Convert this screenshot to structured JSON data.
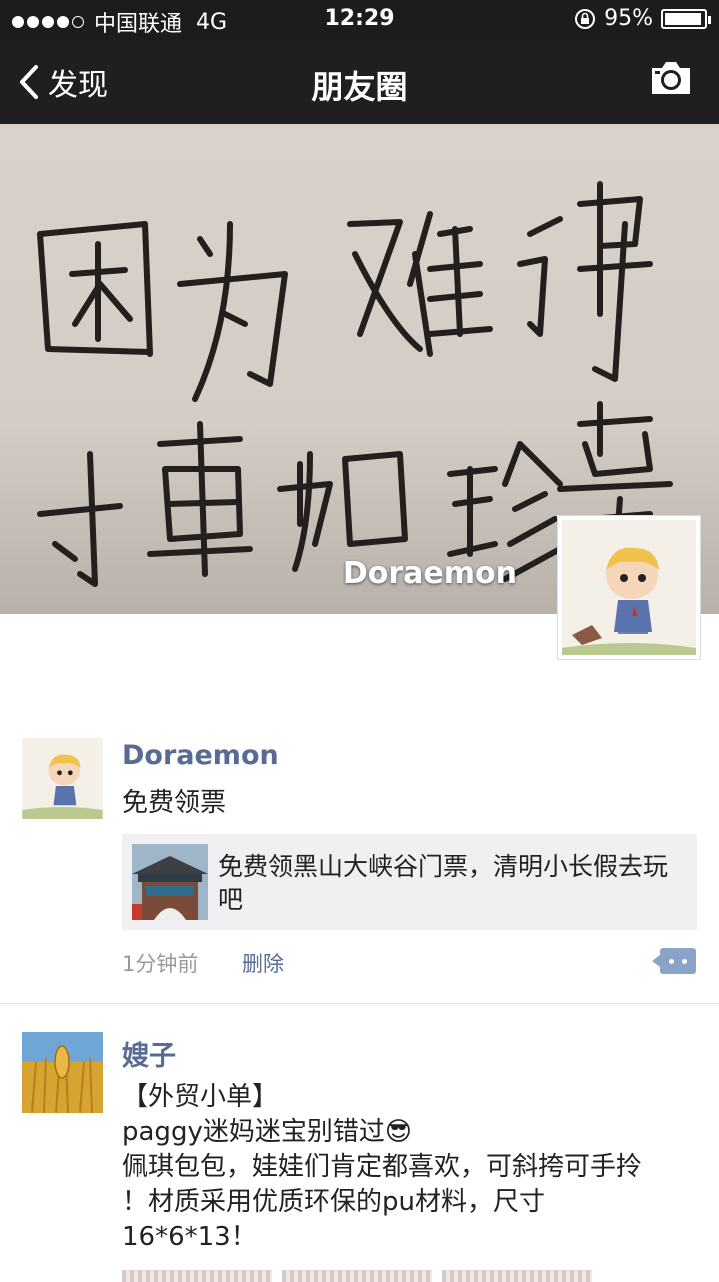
{
  "status_bar": {
    "carrier": "中国联通",
    "network": "4G",
    "time": "12:29",
    "battery": "95%",
    "battery_level": 0.95
  },
  "nav": {
    "back_label": "发现",
    "title": "朋友圈"
  },
  "cover": {
    "handwriting": "因为难得才更加珍贵",
    "user_name": "Doraemon"
  },
  "posts": [
    {
      "name": "Doraemon",
      "text": "免费领票",
      "link_text": "免费领黑山大峡谷门票，清明小长假去玩吧",
      "time": "1分钟前",
      "delete_label": "删除"
    },
    {
      "name": "嫂子",
      "lines": [
        "【外贸小单】",
        "paggy迷妈迷宝别错过😎",
        "佩琪包包，娃娃们肯定都喜欢，可斜挎可手拎",
        "！材质采用优质环保的pu材料，尺寸",
        "16*6*13！"
      ]
    }
  ],
  "colors": {
    "link_blue": "#576b95",
    "bar_dark": "#1f1f21"
  }
}
